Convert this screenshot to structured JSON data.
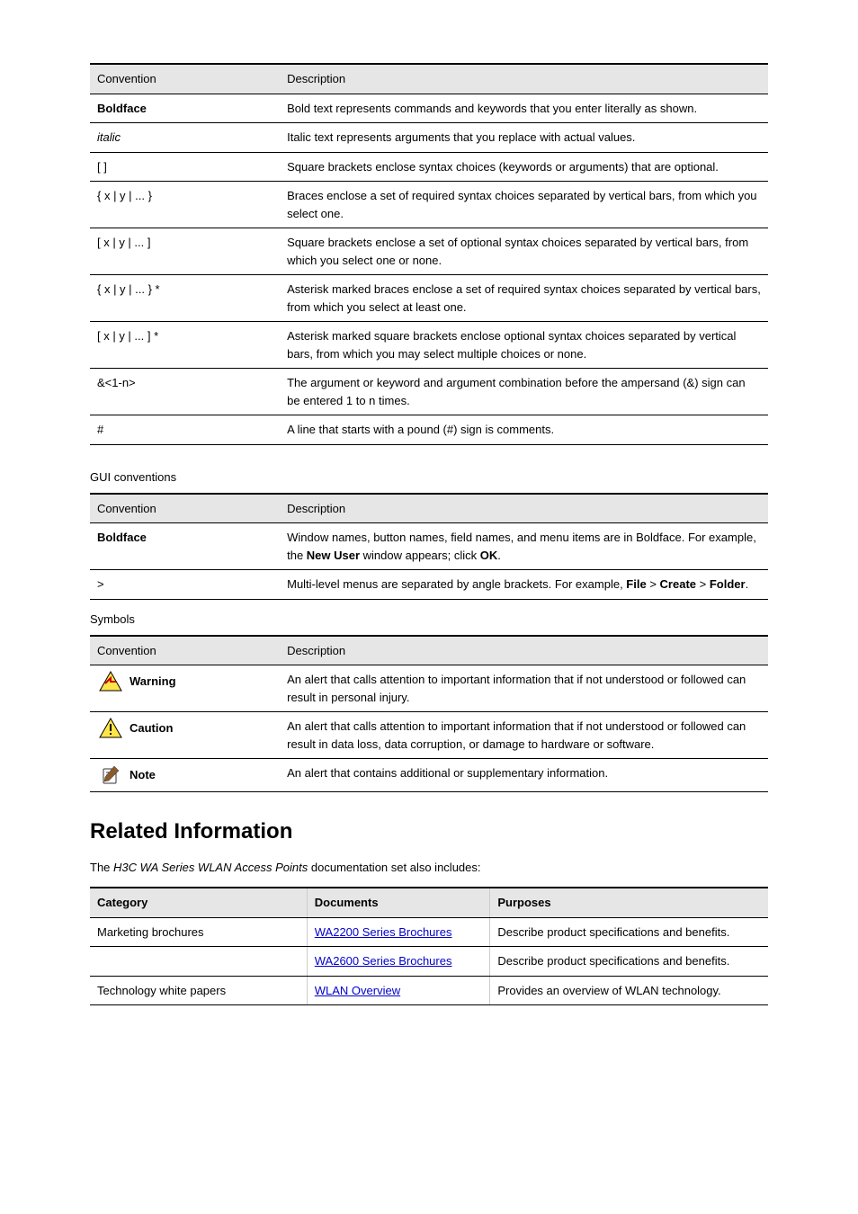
{
  "table1": {
    "head": {
      "c1": "Convention",
      "c2": "Description"
    },
    "rows": [
      {
        "c1": "Boldface",
        "c2": "Bold text represents commands and keywords that you enter literally as shown."
      },
      {
        "c1_html": "<span class='italic'>italic</span>",
        "c2": "Italic text represents arguments that you replace with actual values."
      },
      {
        "c1": "[ ]",
        "c2": "Square brackets enclose syntax choices (keywords or arguments) that are optional."
      },
      {
        "c1": "{ x | y | ... }",
        "c2": "Braces enclose a set of required syntax choices separated by vertical bars, from which you select one."
      },
      {
        "c1": "[ x | y | ... ]",
        "c2": "Square brackets enclose a set of optional syntax choices separated by vertical bars, from which you select one or none."
      },
      {
        "c1": "{ x | y | ... } *",
        "c2": "Asterisk marked braces enclose a set of required syntax choices separated by vertical bars, from which you select at least one."
      },
      {
        "c1": "[ x | y | ... ] *",
        "c2": "Asterisk marked square brackets enclose optional syntax choices separated by vertical bars, from which you may select multiple choices or none."
      },
      {
        "c1": "&<1-n>",
        "c2": "The argument or keyword and argument combination before the ampersand (&) sign can be entered 1 to n times."
      },
      {
        "c1": "#",
        "c2": "A line that starts with a pound (#) sign is comments."
      }
    ]
  },
  "gui_heading": "GUI conventions",
  "table2": {
    "head": {
      "c1": "Convention",
      "c2": "Description"
    },
    "rows": [
      {
        "c1_html": "<span class='bold'>Boldface</span>",
        "c2_html": "Window names, button names, field names, and menu items are in Boldface. For example, the <span class='bold'>New User</span> window appears; click <span class='bold'>OK</span>."
      },
      {
        "c1": ">",
        "c2_html": "Multi-level menus are separated by angle brackets. For example, <span class='bold'>File</span> > <span class='bold'>Create</span> > <span class='bold'>Folder</span>."
      }
    ]
  },
  "symbols_heading": "Symbols",
  "table3": {
    "head": {
      "c1": "Convention",
      "c2": "Description"
    },
    "rows": [
      {
        "icon": "warning",
        "label": "Warning",
        "c2": "An alert that calls attention to important information that if not understood or followed can result in personal injury."
      },
      {
        "icon": "caution",
        "label": "Caution",
        "c2": "An alert that calls attention to important information that if not understood or followed can result in data loss, data corruption, or damage to hardware or software."
      },
      {
        "icon": "note",
        "label": "Note",
        "c2": "An alert that contains additional or supplementary information."
      }
    ]
  },
  "related_heading": "Related Information",
  "related_para_html": "The <span class='italic'>H3C WA Series WLAN Access Points</span> documentation set also includes:",
  "table4": {
    "head": {
      "c1": "Category",
      "c2": "Documents",
      "c3": "Purposes"
    },
    "rows": [
      {
        "c1": "Marketing brochures",
        "c2": "WA2200 Series Brochures",
        "c3": "Describe product specifications and benefits."
      },
      {
        "c1": "",
        "c2": "WA2600 Series Brochures",
        "c3": "Describe product specifications and benefits."
      },
      {
        "c1": "Technology white papers",
        "c2": "WLAN Overview",
        "c3": "Provides an overview of WLAN technology."
      }
    ]
  },
  "colors": {
    "link": "#0000cc",
    "header_bg": "#e6e6e6"
  }
}
